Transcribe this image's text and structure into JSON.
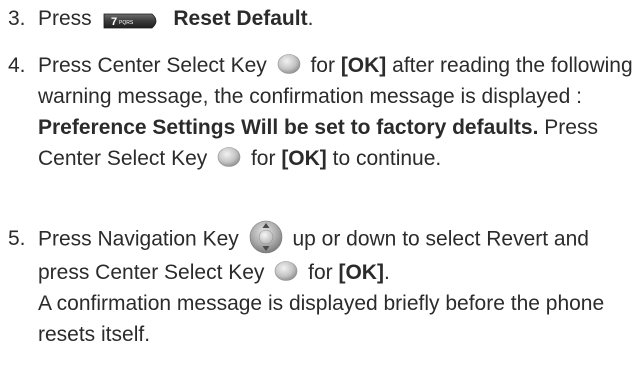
{
  "steps": [
    {
      "number": "3.",
      "press_text": "Press",
      "key_label": "7",
      "key_sub_label": "PQRS",
      "action": "Reset Default",
      "end": "."
    },
    {
      "number": "4.",
      "part1": "Press Center Select Key",
      "part2": "for",
      "ok1": "[OK]",
      "part3": "after reading the following warning message, the confirmation message is displayed :",
      "warning": "Preference Settings Will be set to factory defaults.",
      "part4": "Press Center Select Key",
      "part5": "for",
      "ok2": "[OK]",
      "part6": "to continue."
    },
    {
      "number": "5.",
      "part1": "Press Navigation Key",
      "part2": "up or down to select Revert and press Center Select Key",
      "part3": "for",
      "ok": "[OK]",
      "end": ".",
      "note": "A confirmation message is displayed briefly before the phone resets itself."
    }
  ],
  "icons": {
    "key7": "key-7-pqrs-icon",
    "center": "center-select-key-icon",
    "navigation": "navigation-key-icon"
  },
  "colors": {
    "text": "#2b2b2b",
    "key_dark": "#3a3a3a",
    "key_light": "#bdbdbd"
  }
}
